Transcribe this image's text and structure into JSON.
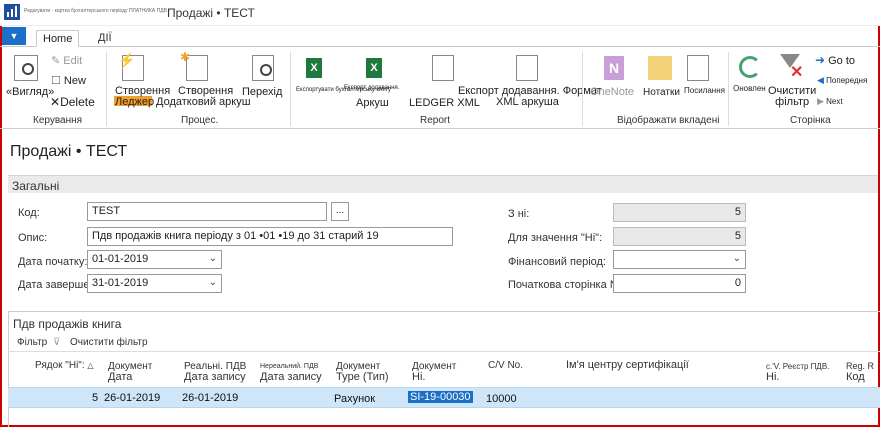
{
  "window": {
    "title": "Продажі • ТЕСТ",
    "app_subtitle": "Редагувати · картка бухгалтерського періоду ПЛАТНИКА ПДВ ·"
  },
  "tabs": [
    "Home",
    "ДІЇ"
  ],
  "ribbon": {
    "manage": {
      "view": "«Вигляд»",
      "edit": "Edit",
      "new": "New",
      "delete": "Delete",
      "group": "Керування"
    },
    "process": {
      "create_ledger": "Створення",
      "ledger": "Леджер",
      "create_extra": "Створення",
      "extra_sheet": "Додатковий аркуш",
      "go": "Перехід",
      "group": "Процес."
    },
    "report": {
      "export_excel": "Експортувати бухгалтерську книгу",
      "export_add": "Експорт додавання.",
      "sheet": "Аркуш",
      "ledger_xml": "LEDGER XML",
      "export_add_format": "Експорт додавання. Формат",
      "xml_sheet": "XML аркуша",
      "group": "Report"
    },
    "attachments": {
      "onenote": "OneNote",
      "notes": "Нотатки",
      "links": "Посилання",
      "group": "Відображати вкладені"
    },
    "page": {
      "refresh": "Оновлен",
      "clear_filter_1": "Очистити",
      "clear_filter_2": "фільтр",
      "goto": "Go to",
      "previous": "Попередня",
      "next": "Next",
      "group": "Сторінка"
    }
  },
  "page_title": "Продажі • ТЕСТ",
  "general": {
    "header": "Загальні",
    "code_label": "Код:",
    "code_value": "TEST",
    "desc_label": "Опис:",
    "desc_value": "Пдв продажів книга періоду з 01 •01 •19 до 31 старий 19",
    "start_label": "Дата початку:",
    "start_value": "01-01-2019",
    "end_label": "Дата завершення:",
    "end_value": "31-01-2019",
    "from_no_label": "З ні:",
    "from_no_value": "5",
    "to_no_label": "Для значення \"Ні\":",
    "to_no_value": "5",
    "fin_period_label": "Фінансовий період:",
    "fin_period_value": "",
    "start_page_label": "Початкова сторінка №:",
    "start_page_value": "0"
  },
  "lines": {
    "header": "Пдв продажів книга",
    "filter": "Фільтр",
    "clear_filter": "Очистити фільтр",
    "columns": {
      "line_no": "Рядок \"Ні\":",
      "doc_date_1": "Документ",
      "doc_date_2": "Дата",
      "real_vat_1": "Реальні. ПДВ",
      "real_vat_2": "Дата запису",
      "unreal_vat_1": "Нереальний. ПДВ",
      "unreal_vat_2": "Дата запису",
      "doc_type_1": "Документ",
      "doc_type_2": "Type (Тип)",
      "doc_no_1": "Документ",
      "doc_no_2": "Ні.",
      "cv_no": "C/V No.",
      "cert_name": "Ім'я центру сертифікації",
      "vat_reg_1": "с.'V. Реєстр ПДВ.",
      "vat_reg_2": "Ні.",
      "reg_code_1": "Reg. R",
      "reg_code_2": "Код"
    },
    "rows": [
      {
        "line_no": "5",
        "doc_date": "26-01-2019",
        "real_vat_date": "26-01-2019",
        "unreal_vat_date": "",
        "doc_type": "Рахунок",
        "doc_no": "SI-19-00030",
        "cv_no": "10000",
        "cert_name": "",
        "vat_reg": "",
        "reg_code": ""
      }
    ]
  }
}
